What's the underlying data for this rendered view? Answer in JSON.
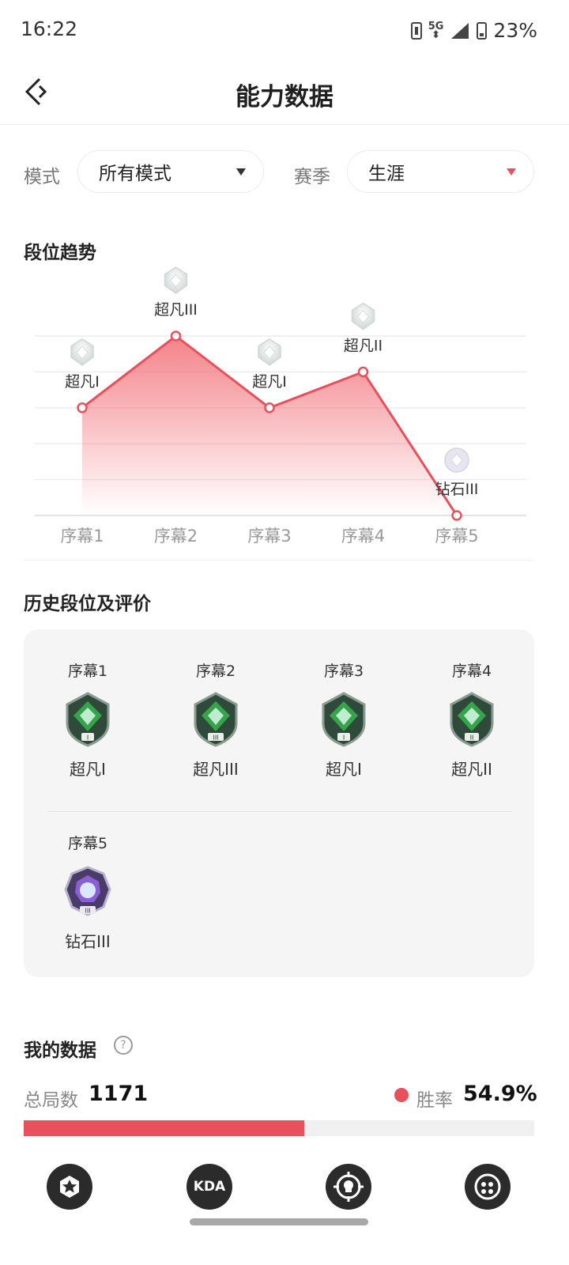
{
  "status_bar": {
    "time": "16:22",
    "network": "5G",
    "battery": "23%"
  },
  "header": {
    "title": "能力数据"
  },
  "filters": {
    "mode_label": "模式",
    "mode_value": "所有模式",
    "season_label": "赛季",
    "season_value": "生涯"
  },
  "trend": {
    "title": "段位趋势",
    "chart_data": {
      "type": "area",
      "categories": [
        "序幕1",
        "序幕2",
        "序幕3",
        "序幕4",
        "序幕5"
      ],
      "rank_labels": [
        "超凡I",
        "超凡III",
        "超凡I",
        "超凡II",
        "钻石III"
      ],
      "values": [
        1,
        3,
        1,
        2,
        -2
      ],
      "value_order": [
        "钻石III",
        "钻石II",
        "钻石I",
        "超凡I",
        "超凡II",
        "超凡III"
      ],
      "ylim": [
        -2,
        3
      ],
      "grid": true,
      "line_color": "#e8515b"
    }
  },
  "history": {
    "title": "历史段位及评价",
    "items": [
      {
        "season": "序幕1",
        "rank": "超凡I",
        "tier": "I",
        "type": "green"
      },
      {
        "season": "序幕2",
        "rank": "超凡III",
        "tier": "III",
        "type": "green"
      },
      {
        "season": "序幕3",
        "rank": "超凡I",
        "tier": "I",
        "type": "green"
      },
      {
        "season": "序幕4",
        "rank": "超凡II",
        "tier": "II",
        "type": "green"
      },
      {
        "season": "序幕5",
        "rank": "钻石III",
        "tier": "III",
        "type": "purple"
      }
    ]
  },
  "my_data": {
    "title": "我的数据",
    "help_icon": "?",
    "total_label": "总局数",
    "total_value": "1171",
    "winrate_label": "胜率",
    "winrate_value": "54.9%",
    "winrate_fraction": 0.549,
    "accent": "#e8515b"
  },
  "bottom_nav": [
    {
      "icon": "star-icon",
      "text": ""
    },
    {
      "icon": "kda-icon",
      "text": "KDA"
    },
    {
      "icon": "target-skull-icon",
      "text": ""
    },
    {
      "icon": "circle-dots-icon",
      "text": ""
    }
  ]
}
